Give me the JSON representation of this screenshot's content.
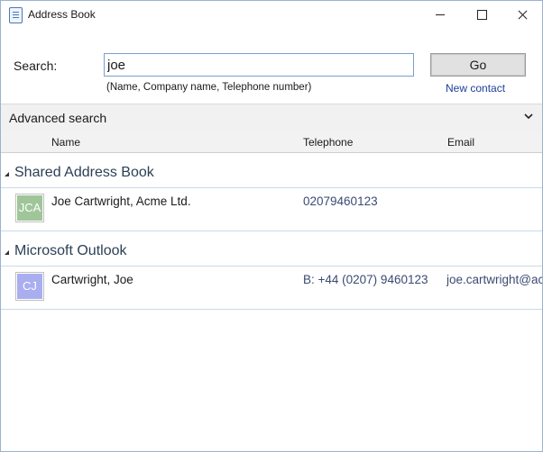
{
  "window": {
    "title": "Address Book"
  },
  "search": {
    "label": "Search:",
    "value": "joe",
    "hint": "(Name, Company name, Telephone number)",
    "go_label": "Go",
    "new_contact_label": "New contact"
  },
  "advanced": {
    "label": "Advanced search"
  },
  "columns": {
    "name": "Name",
    "telephone": "Telephone",
    "email": "Email"
  },
  "groups": [
    {
      "title": "Shared Address Book",
      "contacts": [
        {
          "initials": "JCA",
          "avatar_color": "#9fc599",
          "name": "Joe Cartwright, Acme Ltd.",
          "telephone": "02079460123",
          "email": ""
        }
      ]
    },
    {
      "title": "Microsoft Outlook",
      "contacts": [
        {
          "initials": "CJ",
          "avatar_color": "#a9aef0",
          "name": "Cartwright, Joe",
          "telephone": "B: +44 (0207) 9460123",
          "email": "joe.cartwright@acme.co.uk"
        }
      ]
    }
  ]
}
